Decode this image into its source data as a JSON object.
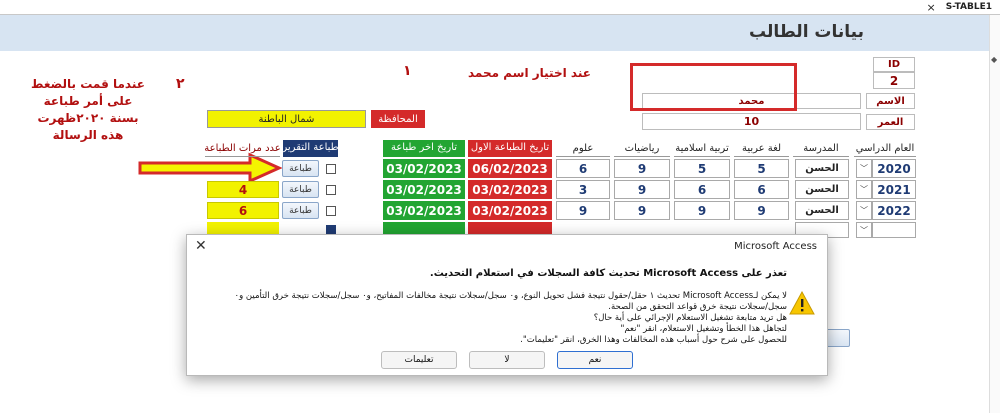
{
  "tab": {
    "label": "S-TABLE1",
    "close": "×"
  },
  "form": {
    "title": "بيانات الطالب"
  },
  "student": {
    "id_label": "ID",
    "id_value": "2",
    "name_label": "الاسم",
    "name_value": "محمد",
    "age_label": "العمر",
    "age_value": "10"
  },
  "governorate": {
    "label": "المحافظة",
    "value": "شمال الباطنة"
  },
  "notes": {
    "n1_number": "١",
    "n1_text": "عند اختيار اسم محمد",
    "n2_number": "٢",
    "n2_text": [
      "عندما قمت بالضغط",
      "على أمر طباعة",
      "بسنة ٢٠٢٠ظهرت",
      "هذه الرسالة"
    ]
  },
  "table": {
    "headers": {
      "year": "العام الدراسي",
      "school": "المدرسة",
      "arabic": "لغة عربية",
      "islamic": "تربية اسلامية",
      "math": "رياضيات",
      "science": "علوم",
      "first_print": "تاريخ الطباعة الاول",
      "last_print": "تاريخ اخر طباعة",
      "print_report": "طباعة التقرير",
      "print_count": "عدد مرات الطباعة"
    },
    "print_button_label": "طباعة",
    "rows": [
      {
        "year": "2020",
        "school": "الحسن",
        "arabic": "5",
        "islamic": "5",
        "math": "9",
        "science": "6",
        "first_print": "06/02/2023",
        "last_print": "03/02/2023",
        "count": ""
      },
      {
        "year": "2021",
        "school": "الحسن",
        "arabic": "6",
        "islamic": "6",
        "math": "9",
        "science": "3",
        "first_print": "03/02/2023",
        "last_print": "03/02/2023",
        "count": "4"
      },
      {
        "year": "2022",
        "school": "الحسن",
        "arabic": "9",
        "islamic": "9",
        "math": "9",
        "science": "9",
        "first_print": "03/02/2023",
        "last_print": "03/02/2023",
        "count": "6"
      }
    ]
  },
  "dialog": {
    "app": "Microsoft Access",
    "close": "✕",
    "heading": "تعذر على Microsoft Access تحديث كافة السجلات في استعلام التحديث.",
    "body": [
      "لا يمكن لـMicrosoft Access تحديث ١ حقل/حقول نتيجة فشل تحويل النوع، و٠ سجل/سجلات نتيجة مخالفات المفاتيح، و٠ سجل/سجلات نتيجة خرق التأمين و٠ سجل/سجلات نتيجة خرق قواعد التحقق من الصحة.",
      "هل تريد متابعة تشغيل الاستعلام الإجرائي على أية حال؟",
      "لتجاهل هذا الخطأ وتشغيل الاستعلام، انقر \"نعم\"",
      "للحصول على شرح حول أسباب هذه المخالفات وهذا الخرق، انقر \"تعليمات\"."
    ],
    "yes": "نعم",
    "no": "لا",
    "help": "تعليمات"
  },
  "colors": {
    "red": "#d42a2a",
    "green": "#22a532",
    "navy": "#1f3b74",
    "yellow": "#f2f200",
    "header_bg": "#d7e4f2"
  }
}
